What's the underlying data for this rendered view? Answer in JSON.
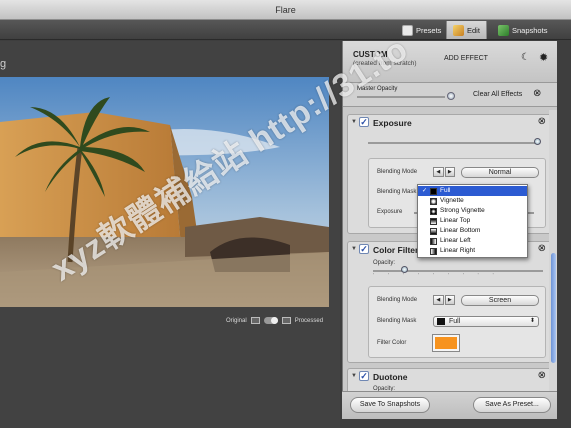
{
  "window": {
    "title": "Flare"
  },
  "toolbar": {
    "presets_label": "Presets",
    "edit_label": "Edit",
    "snapshots_label": "Snapshots"
  },
  "canvas": {
    "partial_label": "g",
    "view_toggle": {
      "original_label": "Original",
      "processed_label": "Processed"
    }
  },
  "panel": {
    "preset_name": "CUSTOM",
    "preset_sub": "(created from scratch)",
    "add_effect_label": "ADD EFFECT",
    "master_opacity_label": "Master Opacity",
    "master_opacity": 0.67,
    "clear_all_label": "Clear All Effects",
    "effects": [
      {
        "title": "Exposure",
        "enabled": true,
        "slider": 0.86,
        "blending_mode_label": "Blending Mode",
        "blending_mode": "Normal",
        "blending_mask_label": "Blending Mask",
        "exposure_label": "Exposure"
      },
      {
        "title": "Color Filter",
        "enabled": true,
        "opacity_label": "Opacity:",
        "opacity": 0.14,
        "blending_mode_label": "Blending Mode",
        "blending_mode": "Screen",
        "blending_mask_label": "Blending Mask",
        "blending_mask": "Full",
        "filter_color_label": "Filter Color",
        "filter_color": "#f7931e"
      },
      {
        "title": "Duotone",
        "enabled": true,
        "opacity_label": "Opacity:"
      }
    ],
    "mask_menu": {
      "items": [
        "Full",
        "Vignette",
        "Strong Vignette",
        "Linear Top",
        "Linear Bottom",
        "Linear Left",
        "Linear Right"
      ],
      "selected": "Full"
    },
    "footer": {
      "save_snapshots_label": "Save To Snapshots",
      "save_preset_label": "Save As Preset..."
    }
  },
  "watermark": "xyz軟體補給站 http://31.to",
  "colors": {
    "accent_blue": "#2c5bd2",
    "filter_orange": "#f7931e"
  }
}
